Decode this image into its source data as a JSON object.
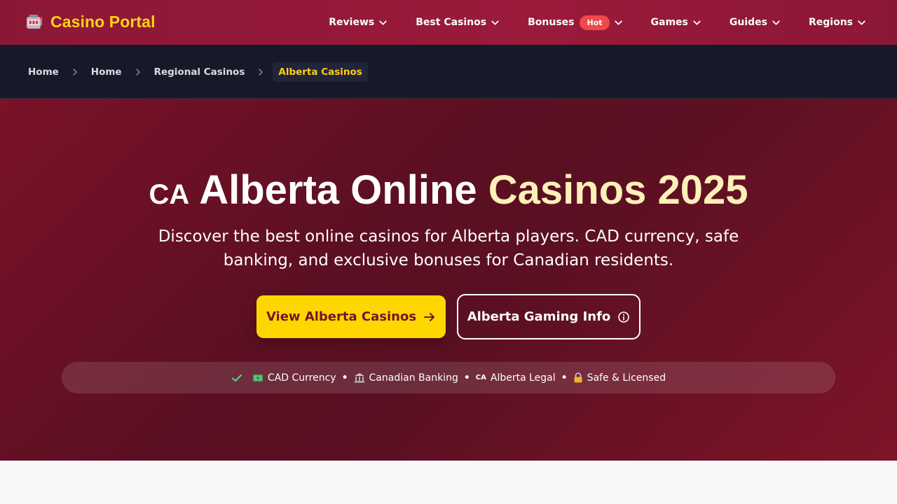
{
  "brand": {
    "name": "Casino Portal",
    "icon": "slot-machine-icon"
  },
  "nav": {
    "items": [
      {
        "label": "Reviews"
      },
      {
        "label": "Best Casinos"
      },
      {
        "label": "Bonuses",
        "badge": "Hot"
      },
      {
        "label": "Games"
      },
      {
        "label": "Guides"
      },
      {
        "label": "Regions"
      }
    ]
  },
  "breadcrumb": {
    "items": [
      "Home",
      "Home",
      "Regional Casinos"
    ],
    "current": "Alberta Casinos"
  },
  "hero": {
    "flag": "CA",
    "title_white": "Alberta Online",
    "title_gold": "Casinos 2025",
    "subtitle": "Discover the best online casinos for Alberta players. CAD currency, safe banking, and exclusive bonuses for Canadian residents.",
    "primary_button": "View Alberta Casinos",
    "secondary_button": "Alberta Gaming Info",
    "features": {
      "cad": "CAD Currency",
      "banking": "Canadian Banking",
      "legal_flag": "CA",
      "legal": "Alberta Legal",
      "safe": "Safe & Licensed",
      "separator": "•"
    }
  },
  "colors": {
    "nav_bg": "#8c1735",
    "brand_gold": "#ffd21a",
    "hero_bg": "#5c0f22",
    "primary_button_bg": "#ffd700",
    "hot_badge": "#f04848",
    "breadcrumb_bg": "#161a28",
    "check_green": "#4ade80"
  }
}
